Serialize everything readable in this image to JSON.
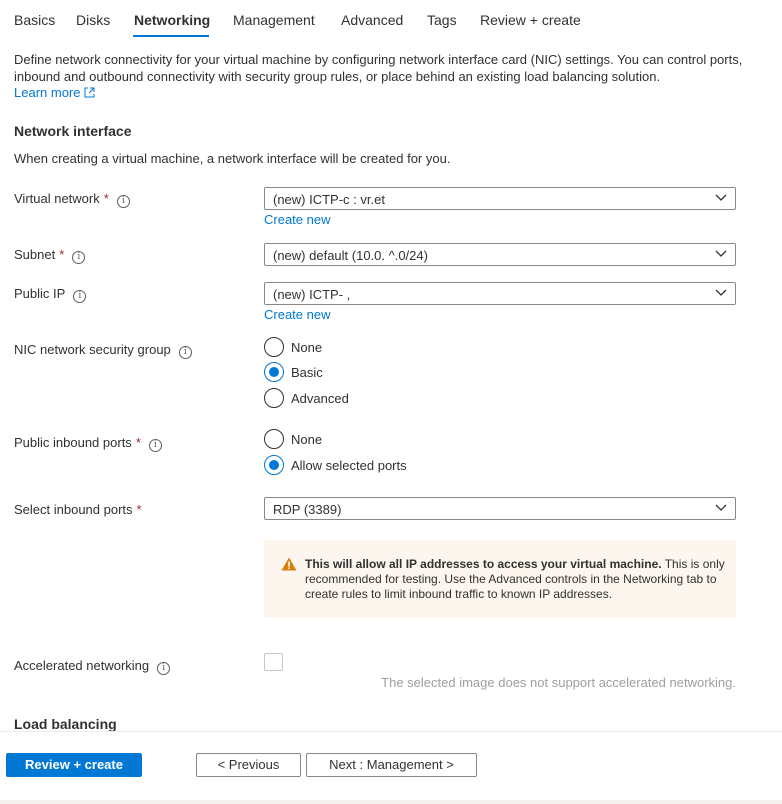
{
  "tabs": [
    {
      "label": "Basics"
    },
    {
      "label": "Disks"
    },
    {
      "label": "Networking"
    },
    {
      "label": "Management"
    },
    {
      "label": "Advanced"
    },
    {
      "label": "Tags"
    },
    {
      "label": "Review + create"
    }
  ],
  "active_tab": "Networking",
  "intro": {
    "text": "Define network connectivity for your virtual machine by configuring network interface card (NIC) settings. You can control ports, inbound and outbound connectivity with security group rules, or place behind an existing load balancing solution.",
    "learn_more": "Learn more"
  },
  "network_interface": {
    "title": "Network interface",
    "subtext": "When creating a virtual machine, a network interface will be created for you."
  },
  "fields": {
    "virtual_network": {
      "label": "Virtual network",
      "value": "(new) ICTP-c  :  vr.et",
      "create_new": "Create new"
    },
    "subnet": {
      "label": "Subnet",
      "value": "(new) default (10.0. ^.0/24)"
    },
    "public_ip": {
      "label": "Public IP",
      "value": "(new) ICTP-  ,",
      "create_new": "Create new"
    },
    "nic_nsg": {
      "label": "NIC network security group",
      "options": [
        "None",
        "Basic",
        "Advanced"
      ],
      "selected": "Basic"
    },
    "public_inbound_ports": {
      "label": "Public inbound ports",
      "options": [
        "None",
        "Allow selected ports"
      ],
      "selected": "Allow selected ports"
    },
    "select_inbound_ports": {
      "label": "Select inbound ports",
      "value": "RDP (3389)"
    },
    "accelerated_networking": {
      "label": "Accelerated networking",
      "checked": false,
      "note": "The selected image does not support accelerated networking."
    }
  },
  "required_marker": "*",
  "info_glyph": "i",
  "warning": {
    "bold": "This will allow all IP addresses to access your virtual machine.",
    "text": " This is only recommended for testing.  Use the Advanced controls in the Networking tab to create rules to limit inbound traffic to known IP addresses."
  },
  "load_balancing": {
    "title": "Load balancing"
  },
  "footer": {
    "review_create": "Review + create",
    "previous": "< Previous",
    "next": "Next : Management >"
  },
  "colors": {
    "accent": "#0078d4",
    "required": "#a4262c",
    "warning_bg": "#fdf6ef",
    "warning_icon": "#d67f0e"
  }
}
